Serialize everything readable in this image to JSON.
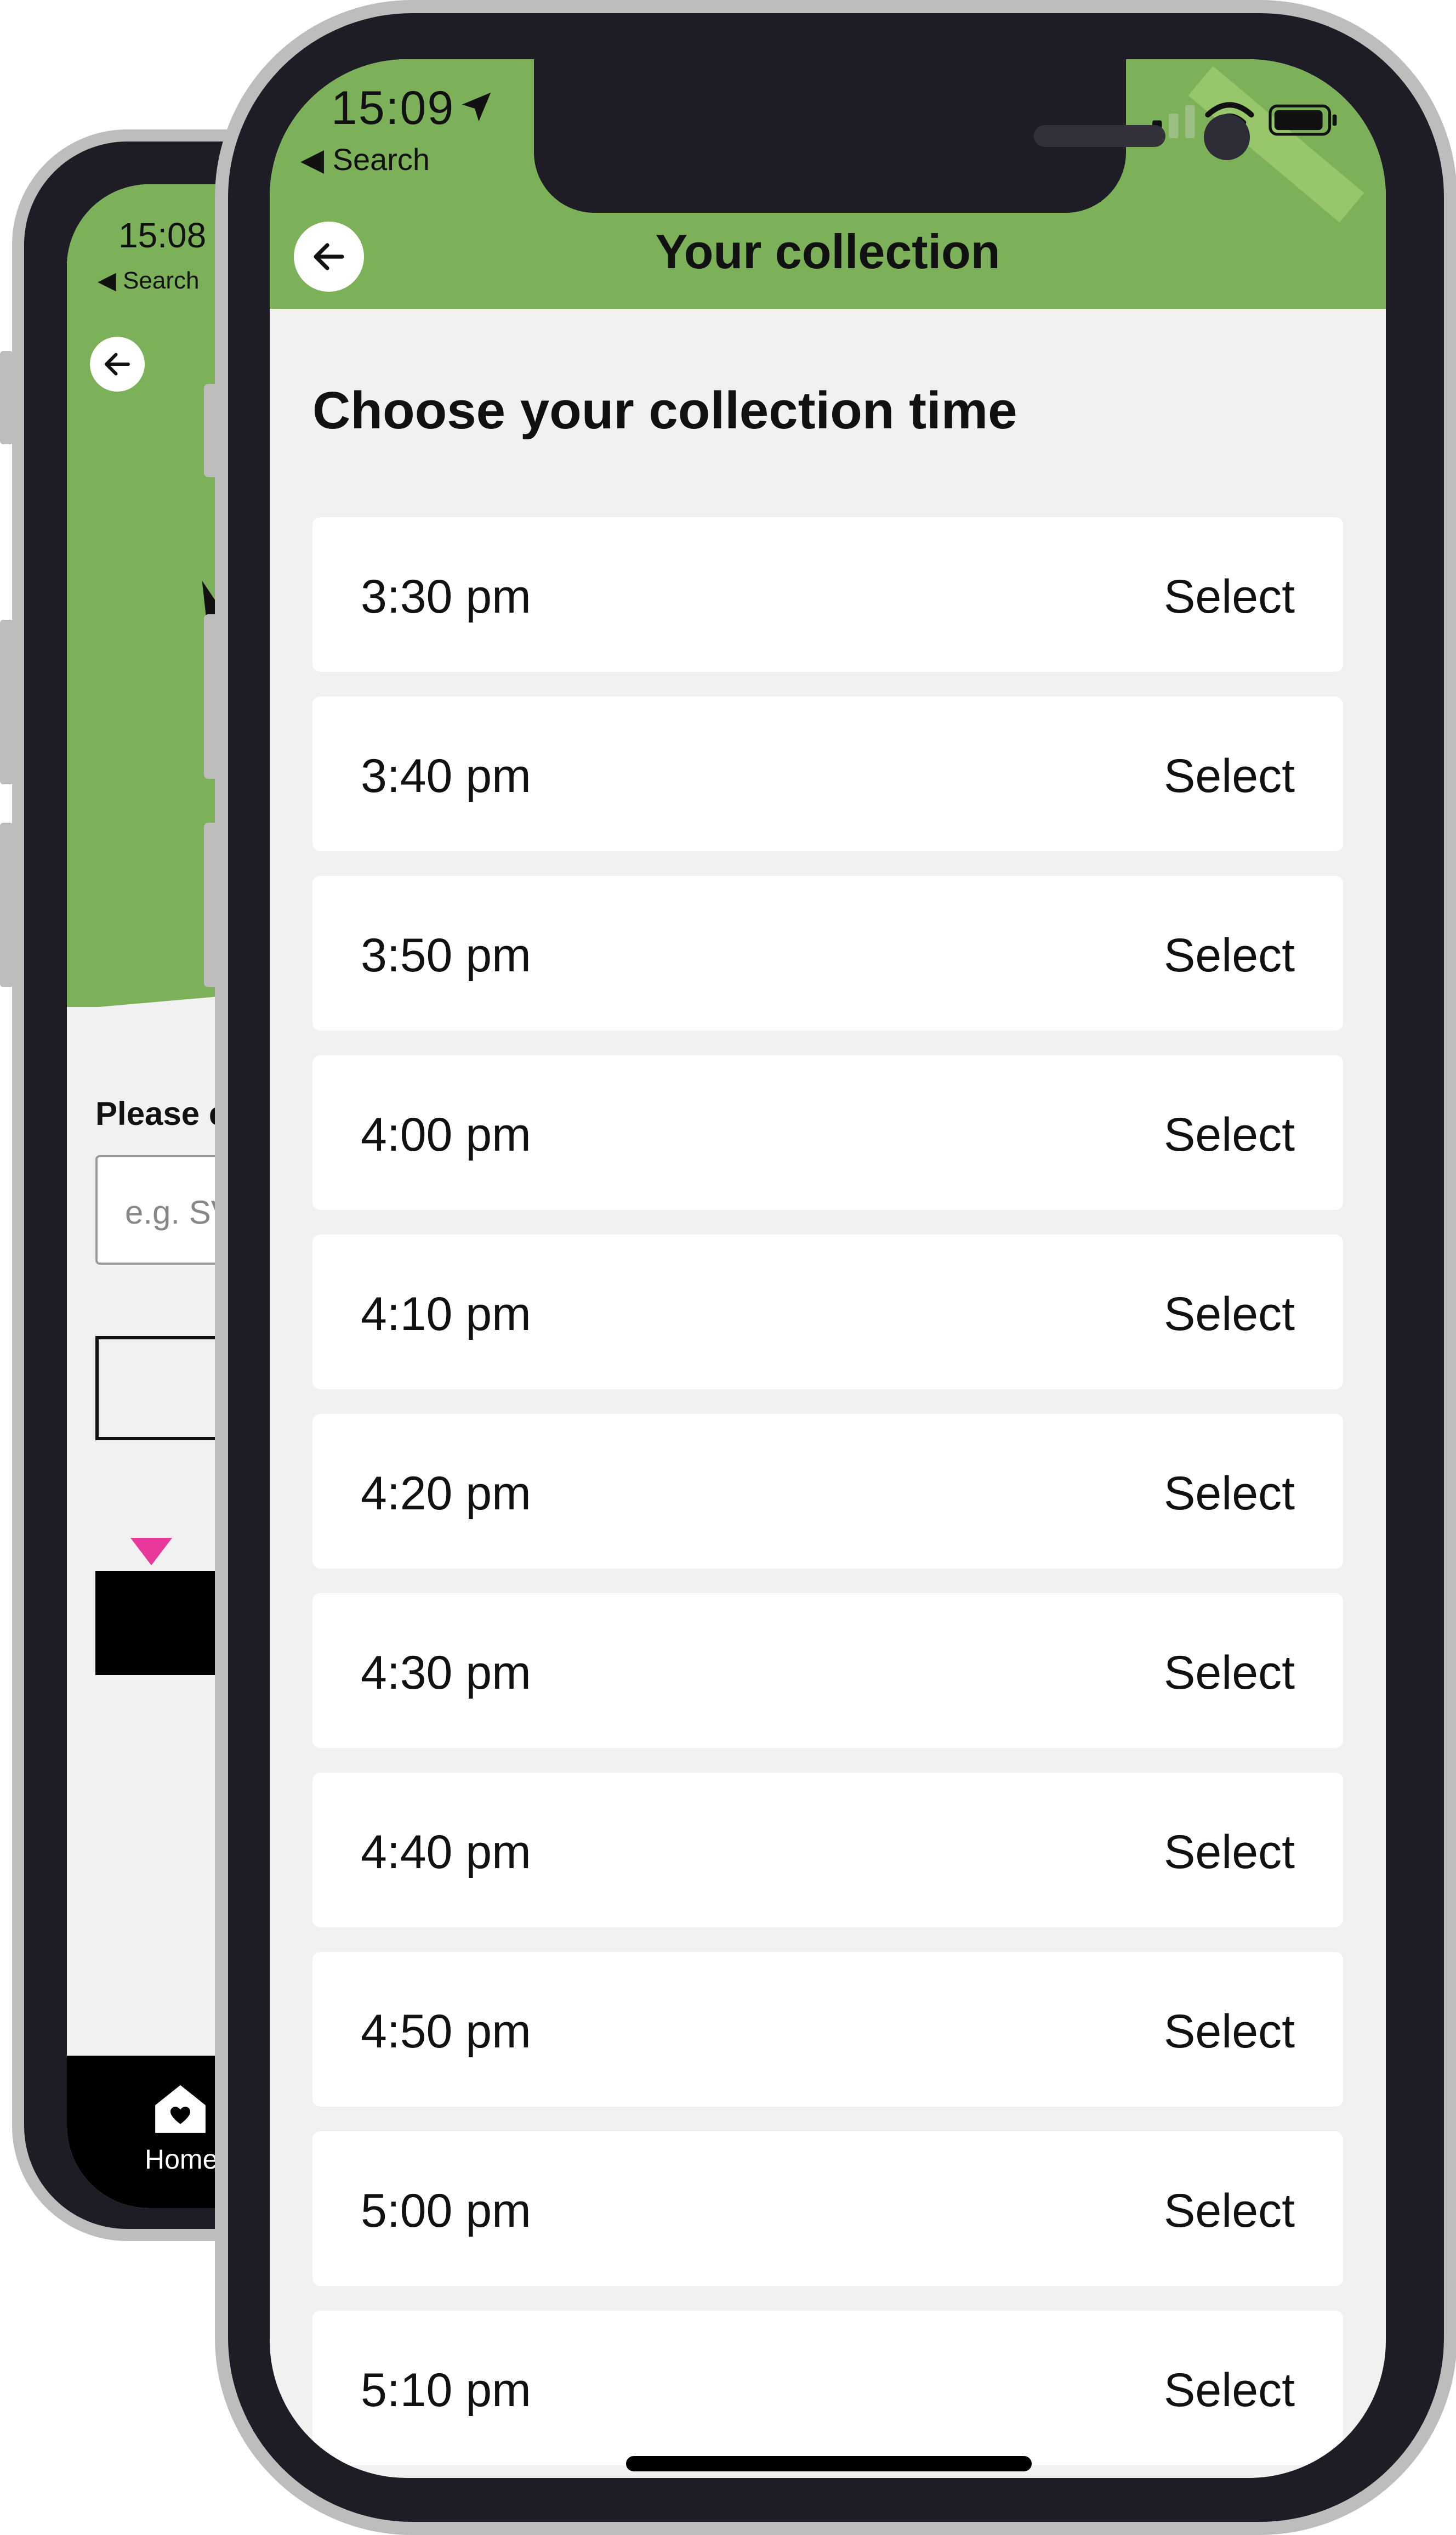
{
  "back_screen": {
    "status_time": "15:08",
    "status_back": "◀ Search",
    "prompt_label": "Please e",
    "postcode_placeholder": "e.g. SV",
    "tab_home_label": "Home"
  },
  "status_bar": {
    "time": "15:09",
    "back_app": "◀ Search"
  },
  "header": {
    "title": "Your collection"
  },
  "main": {
    "section_title": "Choose your collection time",
    "select_label": "Select",
    "slots": [
      {
        "time": "3:30 pm",
        "action": "Select"
      },
      {
        "time": "3:40 pm",
        "action": "Select"
      },
      {
        "time": "3:50 pm",
        "action": "Select"
      },
      {
        "time": "4:00 pm",
        "action": "Select"
      },
      {
        "time": "4:10 pm",
        "action": "Select"
      },
      {
        "time": "4:20 pm",
        "action": "Select"
      },
      {
        "time": "4:30 pm",
        "action": "Select"
      },
      {
        "time": "4:40 pm",
        "action": "Select"
      },
      {
        "time": "4:50 pm",
        "action": "Select"
      },
      {
        "time": "5:00 pm",
        "action": "Select"
      },
      {
        "time": "5:10 pm",
        "action": "Select"
      }
    ]
  },
  "colors": {
    "header_green": "#7cb15a",
    "accent_purple": "#a23cf0",
    "accent_pink": "#e8389c",
    "frame_dark": "#1e1d26",
    "frame_silver": "#bdbdbd",
    "background": "#f1f1f1"
  },
  "icons": [
    "back-arrow-icon",
    "location-arrow-icon",
    "signal-icon",
    "wifi-icon",
    "battery-icon",
    "home-heart-icon"
  ]
}
